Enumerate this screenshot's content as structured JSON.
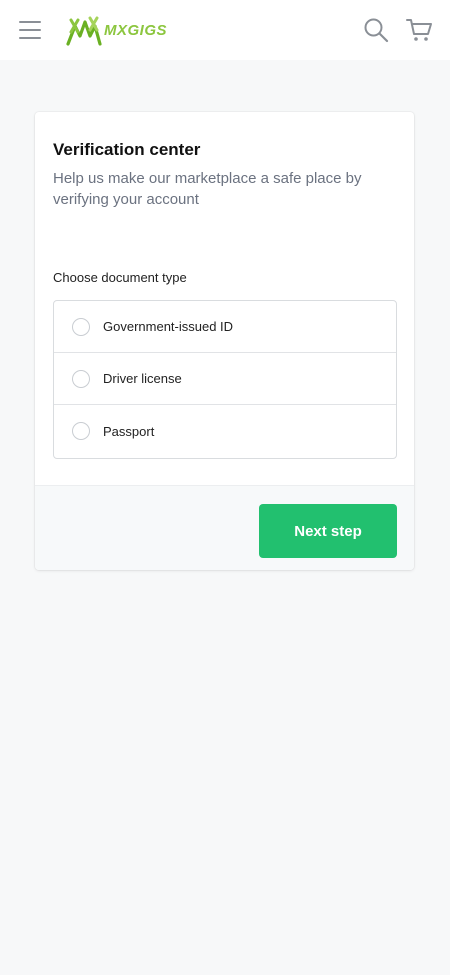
{
  "header": {
    "brand": "MXGIGS",
    "menu_icon": "hamburger-menu-icon",
    "search_icon": "search-icon",
    "cart_icon": "cart-icon",
    "brand_color": "#8cc63f",
    "icon_color": "#8a8f96"
  },
  "card": {
    "title": "Verification center",
    "subtitle": "Help us make our marketplace a safe place by verifying your account",
    "doc_type_label": "Choose document type",
    "options": [
      {
        "label": "Government-issued ID",
        "selected": false
      },
      {
        "label": "Driver license",
        "selected": false
      },
      {
        "label": "Passport",
        "selected": false
      }
    ],
    "next_button_label": "Next step",
    "accent_color": "#22c06f"
  }
}
